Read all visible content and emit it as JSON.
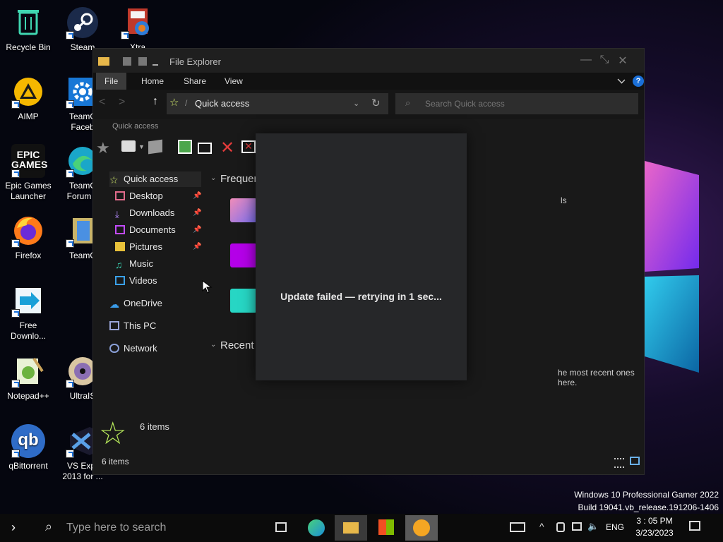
{
  "desktop": {
    "icons": [
      {
        "label": "Recycle Bin"
      },
      {
        "label": "Steam"
      },
      {
        "label": "Xtra"
      },
      {
        "label": "AIMP"
      },
      {
        "label": "TeamC\nFaceb"
      },
      {
        "label": "Epic Games\nLauncher"
      },
      {
        "label": "TeamC\nForum L"
      },
      {
        "label": "Firefox"
      },
      {
        "label": "TeamC"
      },
      {
        "label": "Free\nDownlo..."
      },
      {
        "label": "Notepad++"
      },
      {
        "label": "UltraIS"
      },
      {
        "label": "qBittorrent"
      },
      {
        "label": "VS Expr\n2013 for ..."
      }
    ],
    "epic_logo_text": "EPIC\nGAMES",
    "qb_logo_text": "qb"
  },
  "explorer": {
    "title": "File Explorer",
    "tabs": [
      "File",
      "Home",
      "Share",
      "View"
    ],
    "address": "Quick access",
    "search_placeholder": "Search Quick access",
    "ribbon_group_label": "Quick access",
    "nav": [
      {
        "label": "Quick access"
      },
      {
        "label": "Desktop"
      },
      {
        "label": "Downloads"
      },
      {
        "label": "Documents"
      },
      {
        "label": "Pictures"
      },
      {
        "label": "Music"
      },
      {
        "label": "Videos"
      },
      {
        "label": "OneDrive"
      },
      {
        "label": "This PC"
      },
      {
        "label": "Network"
      }
    ],
    "sections": {
      "frequent": "Frequen",
      "recent": "Recent",
      "frequent_partial_text": "ls",
      "recent_partial_text": "he most recent ones here."
    },
    "status": {
      "items_count": "6 items",
      "items_count_big": "6 items"
    }
  },
  "dialog": {
    "message": "Update failed — retrying in 1 sec..."
  },
  "taskbar": {
    "search_placeholder": "Type here to search",
    "language": "ENG",
    "time": "3 : 05 PM",
    "date": "3/23/2023"
  },
  "system_watermark": {
    "line1": "Windows 10 Professional Gamer 2022",
    "line2": "Build 19041.vb_release.191206-1406"
  },
  "colors": {
    "accent": "#1a6fd8",
    "window_bg": "#191919",
    "dialog_bg": "#262729",
    "taskbar_bg": "#0b0b0b"
  }
}
